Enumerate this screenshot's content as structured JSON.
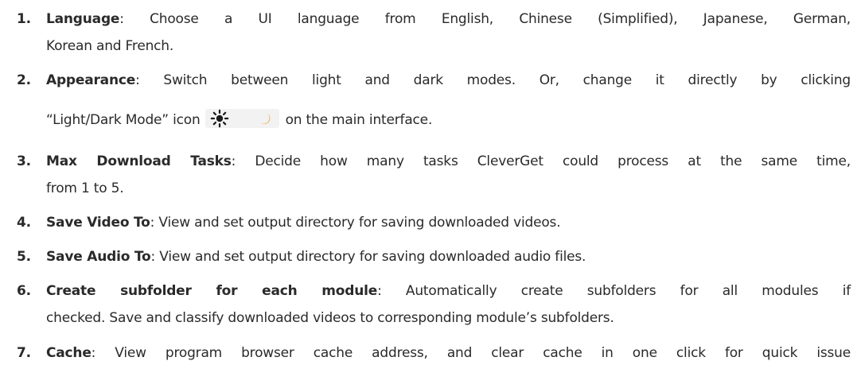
{
  "items": [
    {
      "number": "1.",
      "term": "Language",
      "sep": ":",
      "lines": [
        " Choose a UI language from English, Chinese (Simplified), Japanese, German,",
        "Korean and French."
      ]
    },
    {
      "number": "2.",
      "term": "Appearance",
      "sep": ":",
      "lines": [
        " Switch between light and dark modes. Or, change it directly by clicking"
      ],
      "line2_before": "“Light/Dark Mode” icon",
      "line2_after": "on the main interface.",
      "icon": {
        "name": "light-dark-mode-icon",
        "sun": "sun-icon",
        "moon": "moon-icon"
      }
    },
    {
      "number": "3.",
      "term": "Max Download Tasks",
      "sep": ":",
      "lines": [
        " Decide how many tasks CleverGet could process at the same time,",
        "from 1 to 5."
      ]
    },
    {
      "number": "4.",
      "term": "Save Video To",
      "sep": ":",
      "lines": [
        " View and set output directory for saving downloaded videos."
      ]
    },
    {
      "number": "5.",
      "term": "Save Audio To",
      "sep": ":",
      "lines": [
        " View and set output directory for saving downloaded audio files."
      ]
    },
    {
      "number": "6.",
      "term": "Create subfolder for each module",
      "sep": ":",
      "lines": [
        " Automatically create subfolders for all modules if",
        "checked. Save and classify downloaded videos to corresponding module’s subfolders."
      ]
    },
    {
      "number": "7.",
      "term": "Cache",
      "sep": ":",
      "lines": [
        " View program browser cache address, and clear cache in one click for quick issue"
      ]
    }
  ],
  "colors": {
    "text": "#2a2a2a",
    "icon_bg": "#f2f2f2",
    "sun": "#1a1a1a",
    "moon": "#e8a33a"
  }
}
